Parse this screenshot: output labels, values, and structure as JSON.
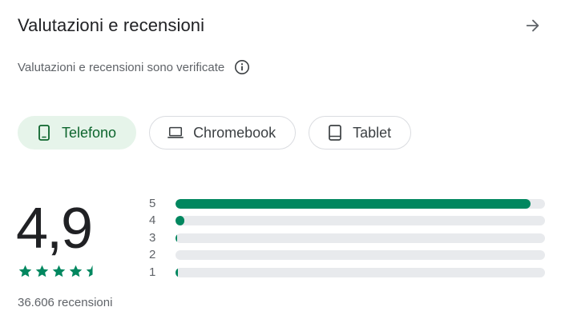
{
  "header": {
    "title": "Valutazioni e recensioni",
    "arrow_icon": "arrow-forward-icon"
  },
  "verified": {
    "text": "Valutazioni e recensioni sono verificate",
    "icon": "info-icon"
  },
  "device_tabs": [
    {
      "label": "Telefono",
      "icon": "phone-icon",
      "selected": true
    },
    {
      "label": "Chromebook",
      "icon": "laptop-icon",
      "selected": false
    },
    {
      "label": "Tablet",
      "icon": "tablet-icon",
      "selected": false
    }
  ],
  "rating": {
    "score": "4,9",
    "stars_value": 4.9,
    "review_count": "36.606 recensioni"
  },
  "histogram": [
    {
      "label": "5",
      "fraction": 0.96
    },
    {
      "label": "4",
      "fraction": 0.024
    },
    {
      "label": "3",
      "fraction": 0.004
    },
    {
      "label": "2",
      "fraction": 0.0
    },
    {
      "label": "1",
      "fraction": 0.006
    }
  ],
  "colors": {
    "accent_green": "#01875f",
    "chip_selected_bg": "#e6f4ea",
    "chip_selected_text": "#0d652d",
    "track_gray": "#e8eaed",
    "text_primary": "#202124",
    "text_secondary": "#5f6368"
  }
}
